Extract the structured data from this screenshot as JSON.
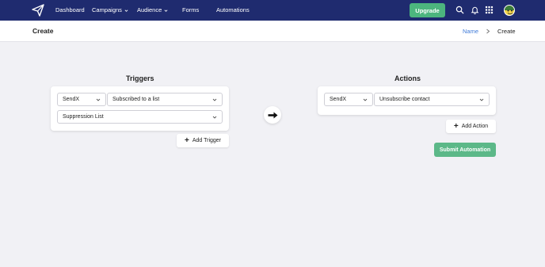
{
  "nav": {
    "items": [
      {
        "label": "Dashboard"
      },
      {
        "label": "Campaigns"
      },
      {
        "label": "Audience"
      },
      {
        "label": "Forms"
      },
      {
        "label": "Automations"
      }
    ],
    "upgrade_label": "Upgrade",
    "icons": [
      "send-logo-icon",
      "search-icon",
      "bell-icon",
      "grid-icon",
      "avatar"
    ]
  },
  "header": {
    "title": "Create",
    "breadcrumb": {
      "link": "Name",
      "current": "Create"
    }
  },
  "triggers": {
    "title": "Triggers",
    "source_select": "SendX",
    "event_select": "Subscribed to a list",
    "list_select": "Suppression List",
    "add_label": "Add Trigger"
  },
  "actions": {
    "title": "Actions",
    "source_select": "SendX",
    "action_select": "Unsubscribe contact",
    "add_label": "Add Action"
  },
  "submit_label": "Submit Automation",
  "colors": {
    "nav_bg": "#1f2b6f",
    "upgrade_bg": "#4cb57e",
    "submit_bg": "#5cb888",
    "link": "#3f7ad8",
    "page_bg": "#f1f1f5"
  }
}
